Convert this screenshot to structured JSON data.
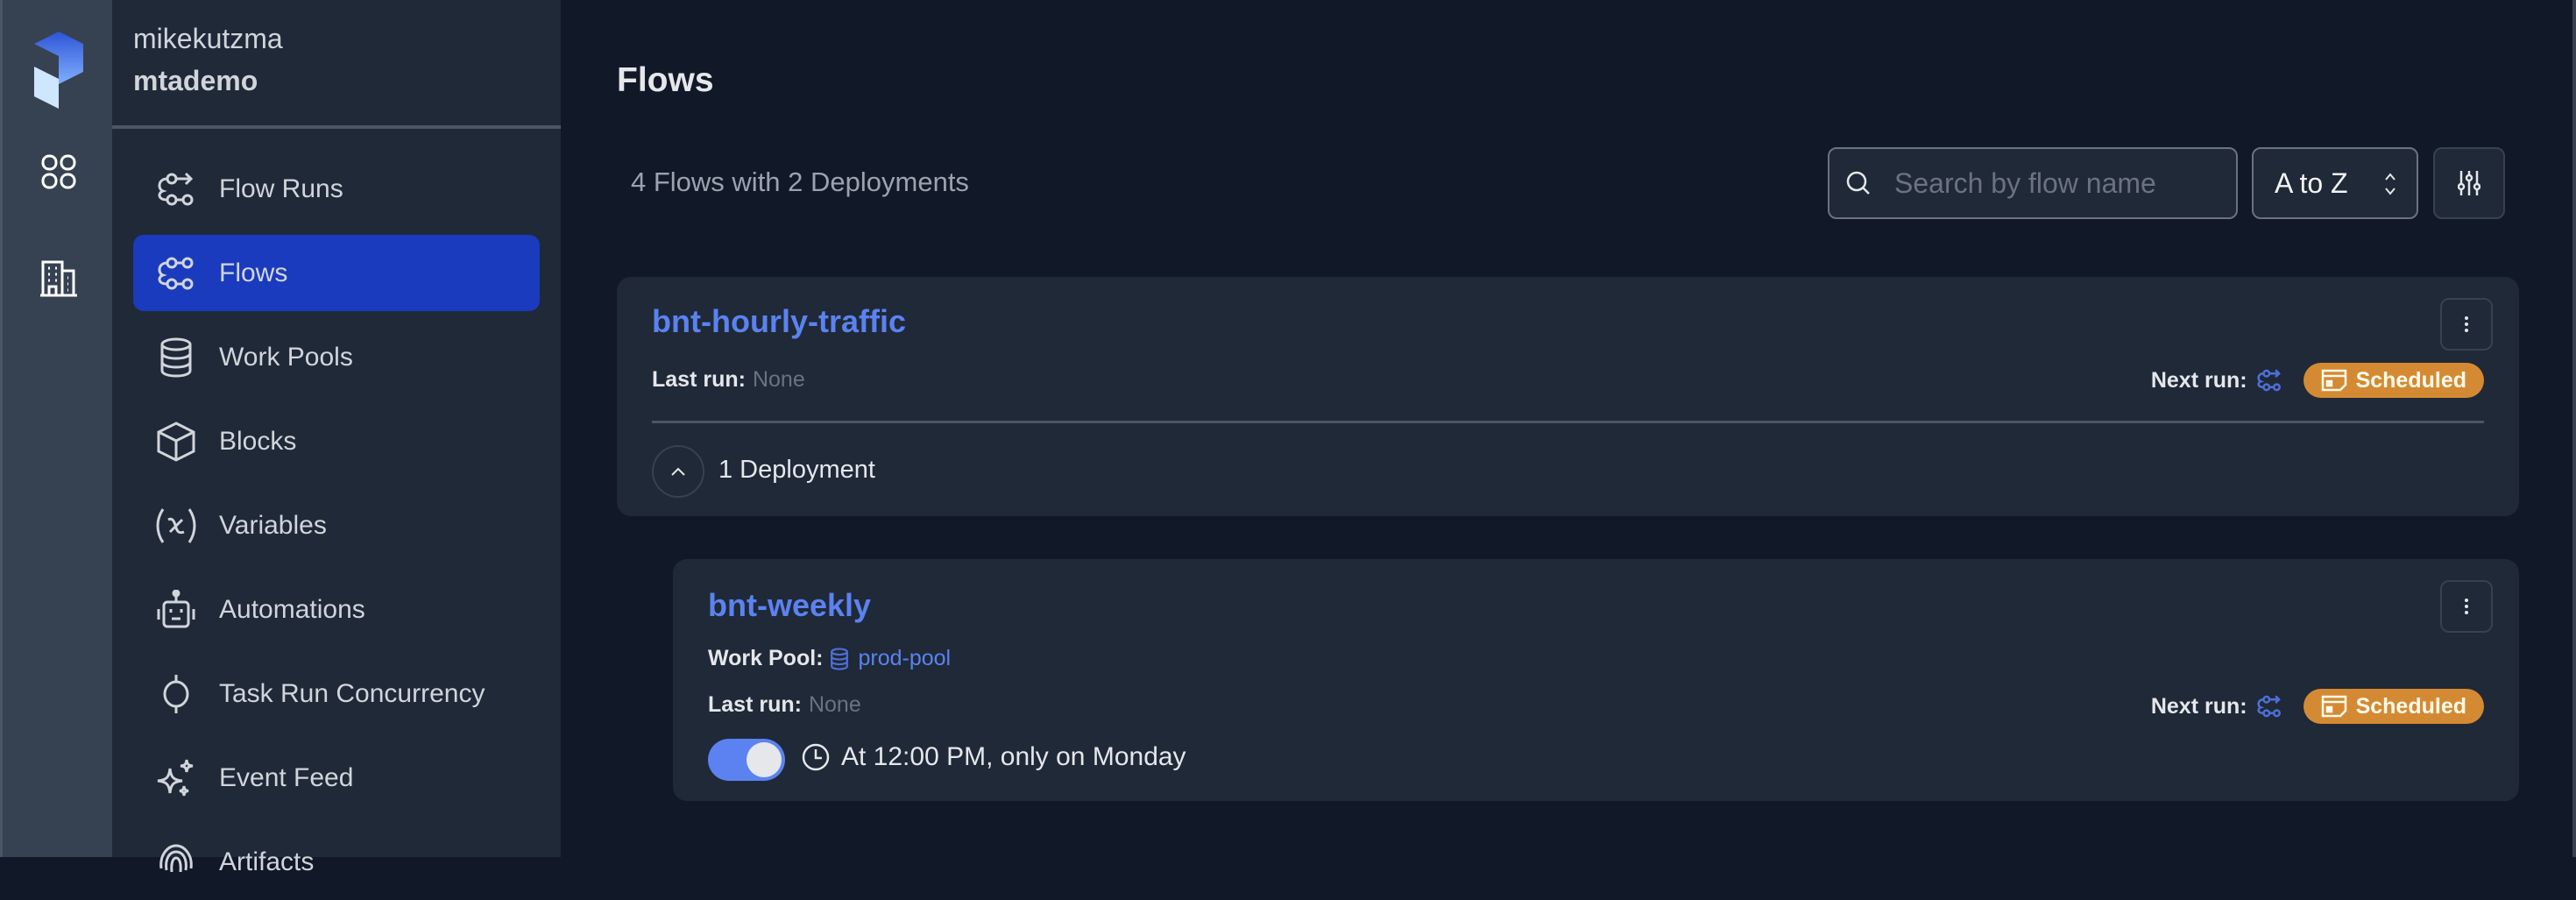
{
  "rail": {
    "icons": [
      "prefect-logo-icon",
      "dashboard-grid-icon",
      "building-icon"
    ]
  },
  "workspace": {
    "account": "mikekutzma",
    "name": "mtademo"
  },
  "sidebar": {
    "items": [
      {
        "label": "Flow Runs",
        "icon": "flow-runs-icon",
        "active": false
      },
      {
        "label": "Flows",
        "icon": "flows-icon",
        "active": true
      },
      {
        "label": "Work Pools",
        "icon": "database-icon",
        "active": false
      },
      {
        "label": "Blocks",
        "icon": "cube-icon",
        "active": false
      },
      {
        "label": "Variables",
        "icon": "variable-icon",
        "active": false
      },
      {
        "label": "Automations",
        "icon": "robot-icon",
        "active": false
      },
      {
        "label": "Task Run Concurrency",
        "icon": "concurrency-icon",
        "active": false
      },
      {
        "label": "Event Feed",
        "icon": "sparkles-icon",
        "active": false
      },
      {
        "label": "Artifacts",
        "icon": "fingerprint-icon",
        "active": false
      }
    ]
  },
  "page": {
    "title": "Flows",
    "count_text": "4 Flows with 2 Deployments",
    "search": {
      "placeholder": "Search by flow name",
      "value": ""
    },
    "sort": {
      "selected": "A to Z"
    }
  },
  "flows": [
    {
      "name": "bnt-hourly-traffic",
      "last_run_label": "Last run:",
      "last_run_value": "None",
      "next_run_label": "Next run:",
      "status": "Scheduled",
      "deployments_label": "1 Deployment",
      "deployments": [
        {
          "name": "bnt-weekly",
          "work_pool_label": "Work Pool:",
          "work_pool": "prod-pool",
          "last_run_label": "Last run:",
          "last_run_value": "None",
          "next_run_label": "Next run:",
          "status": "Scheduled",
          "schedule_active": true,
          "schedule": "At 12:00 PM, only on Monday"
        }
      ]
    }
  ],
  "colors": {
    "accent": "#5b82f0",
    "nav_active": "#1a3bbd",
    "scheduled": "#d48a33",
    "background": "#111827",
    "card": "#1f2937"
  }
}
